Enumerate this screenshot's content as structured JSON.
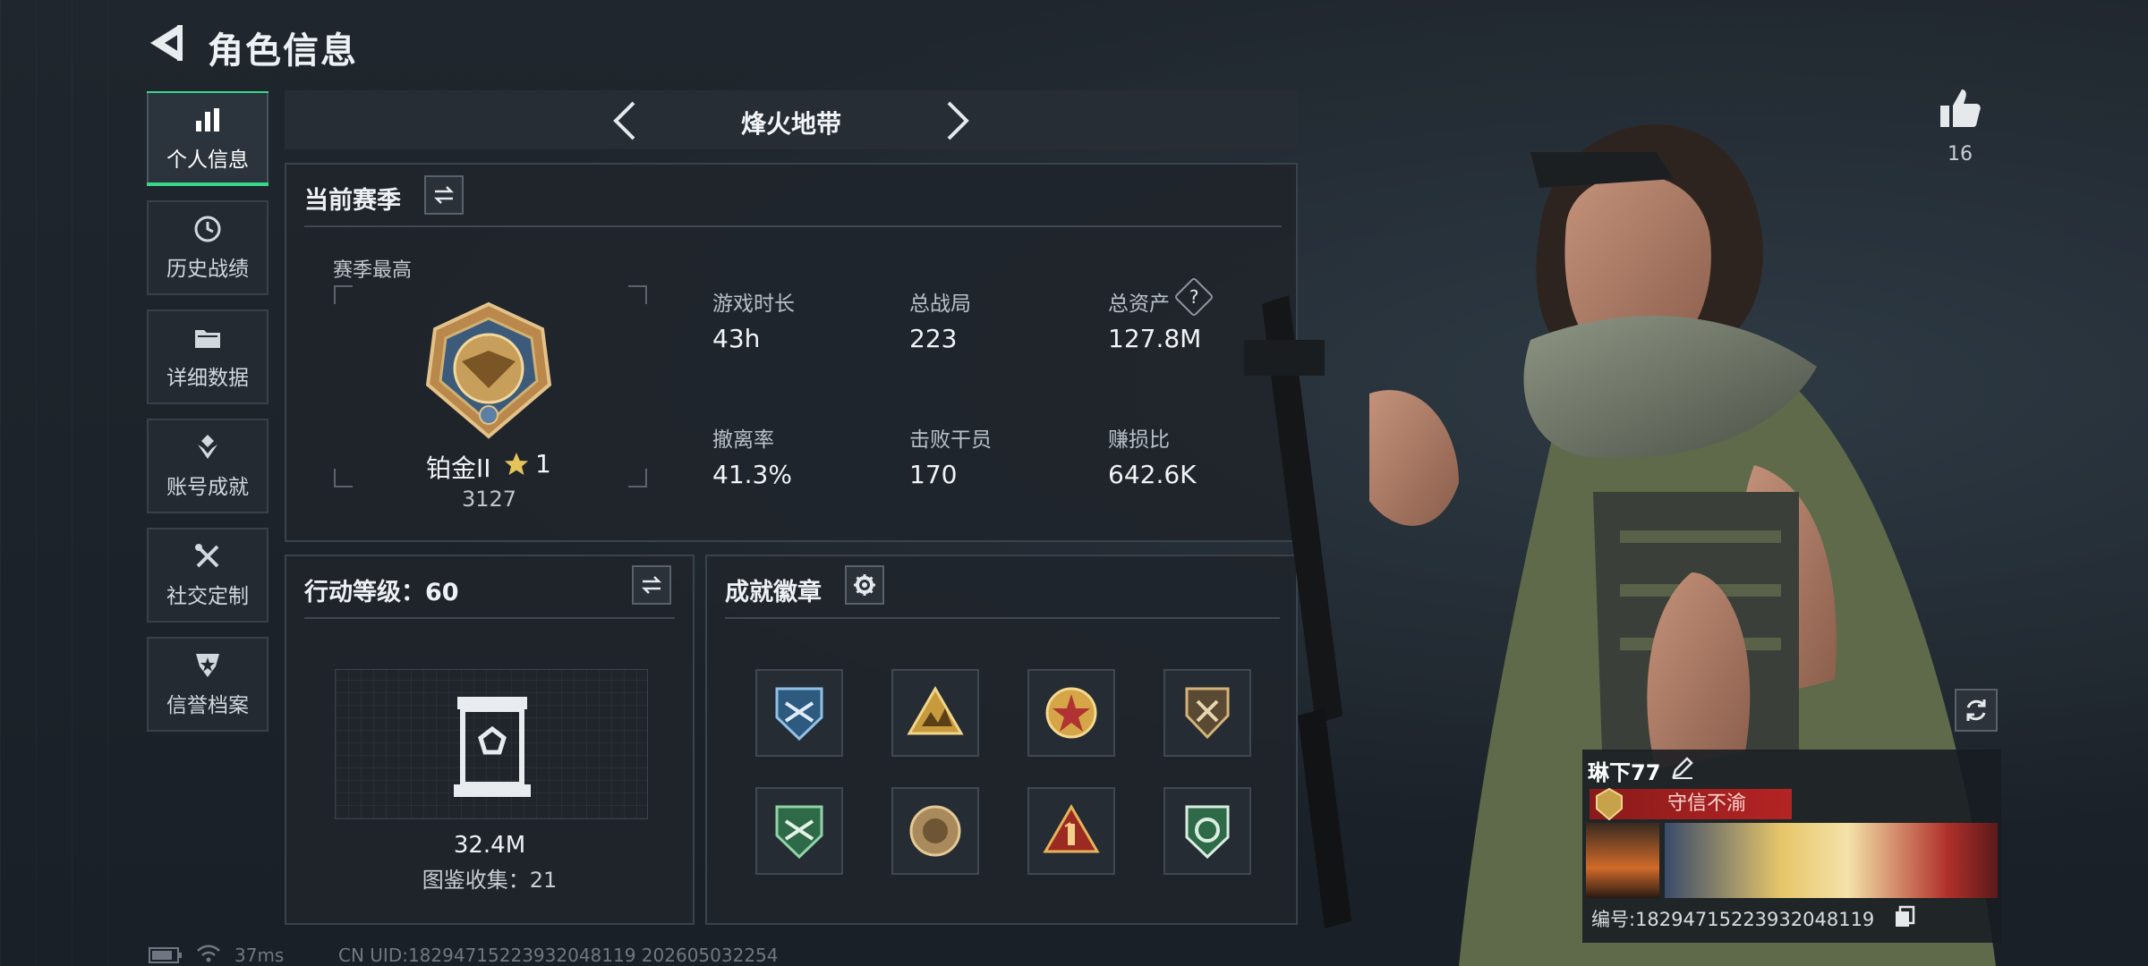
{
  "header": {
    "title": "角色信息"
  },
  "sidebar": {
    "items": [
      {
        "label": "个人信息",
        "icon": "bar-chart-icon",
        "active": true
      },
      {
        "label": "历史战绩",
        "icon": "clock-icon"
      },
      {
        "label": "详细数据",
        "icon": "folder-icon"
      },
      {
        "label": "账号成就",
        "icon": "achievement-diamond-icon"
      },
      {
        "label": "社交定制",
        "icon": "wrench-screwdriver-icon"
      },
      {
        "label": "信誉档案",
        "icon": "shield-star-icon"
      }
    ]
  },
  "mode_bar": {
    "title": "烽火地带"
  },
  "season": {
    "title": "当前赛季",
    "highest_label": "赛季最高",
    "rank_name": "铂金II",
    "rank_star_value": "1",
    "rank_score": "3127",
    "stats": [
      {
        "label": "游戏时长",
        "value": "43h"
      },
      {
        "label": "总战局",
        "value": "223"
      },
      {
        "label": "总资产",
        "value": "127.8M",
        "help": "?"
      },
      {
        "label": "撤离率",
        "value": "41.3%"
      },
      {
        "label": "击败干员",
        "value": "170"
      },
      {
        "label": "赚损比",
        "value": "642.6K"
      }
    ]
  },
  "action_level": {
    "title": "行动等级：60",
    "asset_value": "32.4M",
    "collection": "图鉴收集：21"
  },
  "achievements": {
    "title": "成就徽章",
    "badges": [
      "achievement-badge-1-icon",
      "achievement-badge-2-icon",
      "achievement-badge-3-icon",
      "achievement-badge-4-icon",
      "achievement-badge-5-icon",
      "achievement-badge-6-icon",
      "achievement-badge-7-icon",
      "achievement-badge-8-icon"
    ]
  },
  "likes": {
    "count": "16"
  },
  "profile": {
    "name": "琳下77",
    "reputation": "守信不渝",
    "id_text": "编号:18294715223932048119"
  },
  "status_bar": {
    "latency": "37ms",
    "uid_text": "CN UID:18294715223932048119 202605032254"
  },
  "colors": {
    "accent": "#38d68a",
    "reputation_red": "#b42424",
    "gold": "#c8a24a"
  }
}
